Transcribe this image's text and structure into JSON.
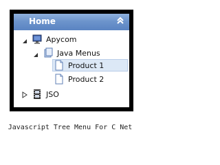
{
  "menu": {
    "header_title": "Home",
    "collapse_icon": "double-chevron-up-icon",
    "items": [
      {
        "label": "Apycom",
        "icon": "monitor-icon",
        "state": "expanded"
      },
      {
        "label": "Java Menus",
        "icon": "folder-icon",
        "state": "expanded"
      },
      {
        "label": "Product 1",
        "icon": "document-icon",
        "state": "selected"
      },
      {
        "label": "Product 2",
        "icon": "document-icon",
        "state": "normal"
      },
      {
        "label": "JSO",
        "icon": "filmstrip-icon",
        "state": "collapsed"
      }
    ]
  },
  "caption": "Javascript Tree Menu For C Net",
  "colors": {
    "header_gradient_top": "#8fb1dd",
    "header_gradient_bottom": "#5a84c2",
    "frame": "#000000",
    "selected_row": "#dce8f6"
  }
}
